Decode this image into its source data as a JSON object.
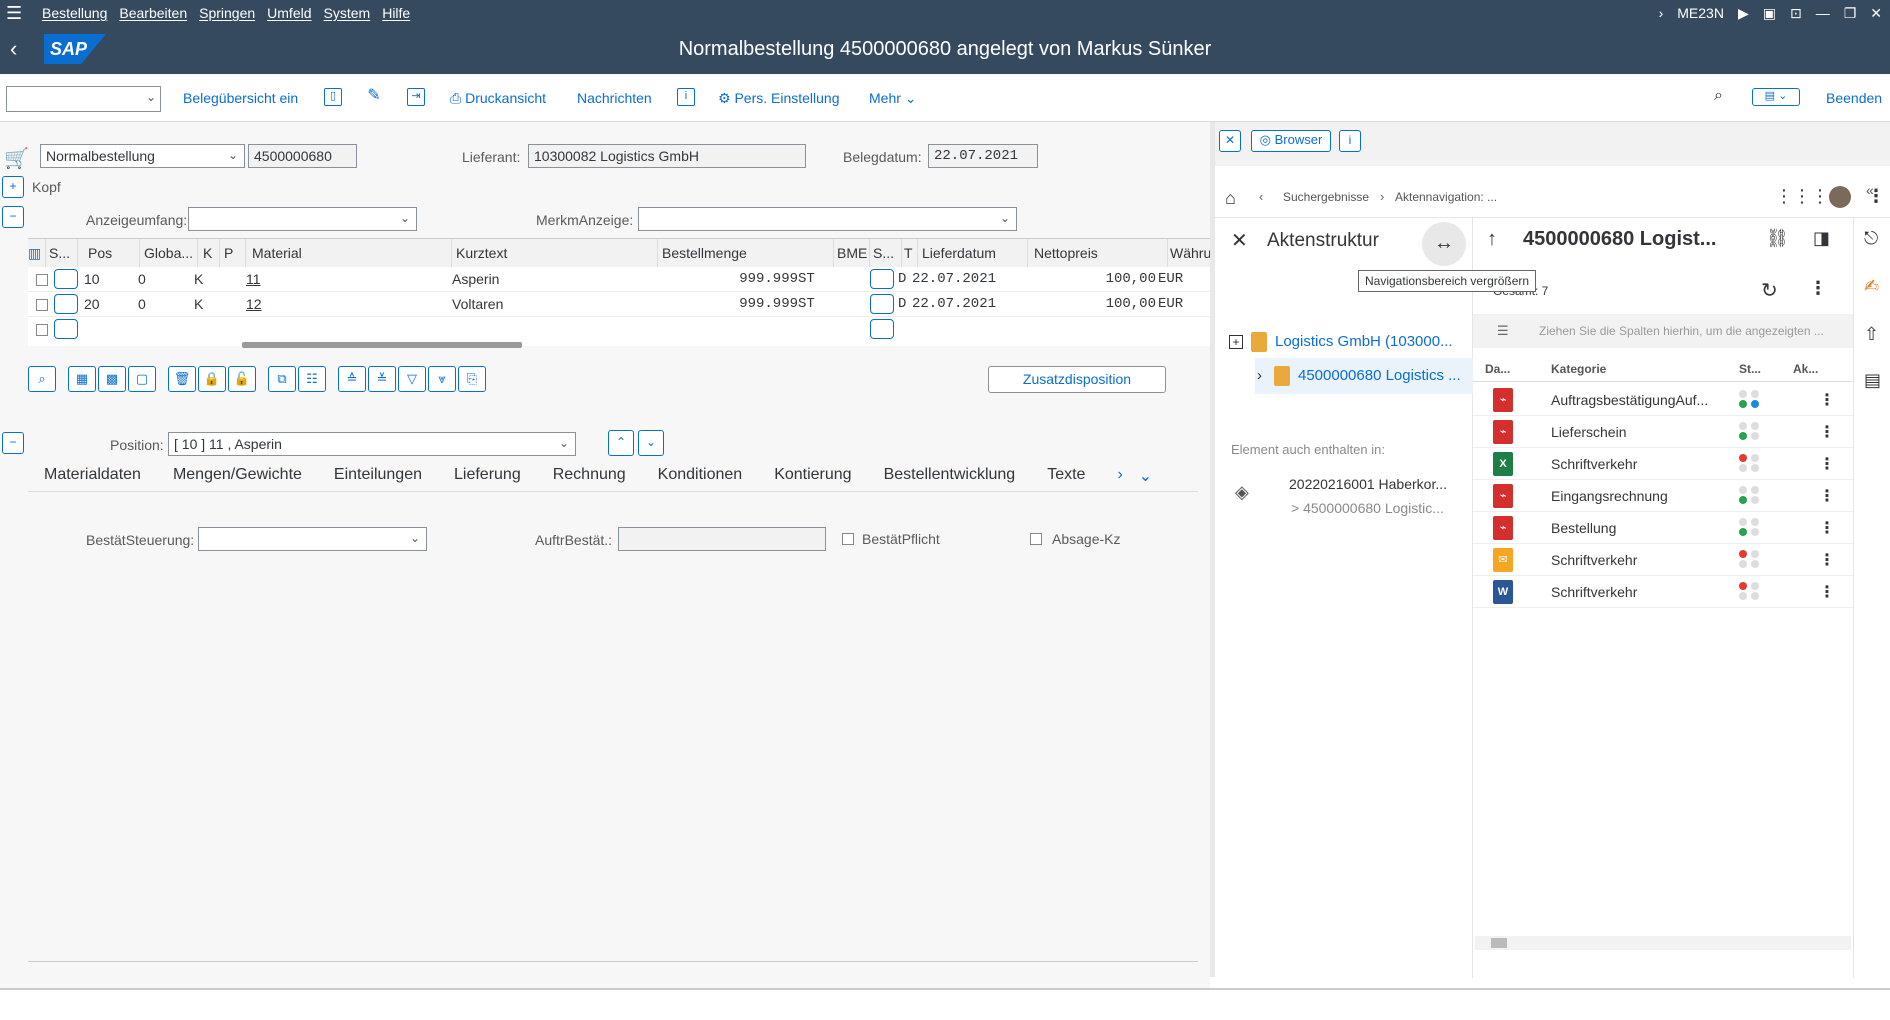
{
  "menu": {
    "items": [
      "Bestellung",
      "Bearbeiten",
      "Springen",
      "Umfeld",
      "System",
      "Hilfe"
    ],
    "tcode": "ME23N"
  },
  "title": "Normalbestellung 4500000680 angelegt von Markus Sünker",
  "toolbar": {
    "beleg": "Belegübersicht ein",
    "druck": "Druckansicht",
    "nachrichten": "Nachrichten",
    "pers": "Pers. Einstellung",
    "mehr": "Mehr",
    "beenden": "Beenden"
  },
  "header": {
    "doctype": "Normalbestellung",
    "docnum": "4500000680",
    "lieferant_label": "Lieferant:",
    "lieferant": "10300082 Logistics GmbH",
    "belegdatum_label": "Belegdatum:",
    "belegdatum": "22.07.2021",
    "kopf": "Kopf",
    "anzeige_label": "Anzeigeumfang:",
    "merkm_label": "MerkmAnzeige:"
  },
  "table": {
    "headers": [
      "S...",
      "Pos",
      "Globa...",
      "K",
      "P",
      "Material",
      "Kurztext",
      "Bestellmenge",
      "BME",
      "S...",
      "T",
      "Lieferdatum",
      "Nettopreis",
      "Währun"
    ],
    "rows": [
      {
        "pos": "10",
        "glob": "0",
        "k": "K",
        "material": "11",
        "kurztext": "Asperin",
        "menge": "999.999",
        "bme": "ST",
        "t": "D",
        "datum": "22.07.2021",
        "preis": "100,00",
        "waehrung": "EUR"
      },
      {
        "pos": "20",
        "glob": "0",
        "k": "K",
        "material": "12",
        "kurztext": "Voltaren",
        "menge": "999.999",
        "bme": "ST",
        "t": "D",
        "datum": "22.07.2021",
        "preis": "100,00",
        "waehrung": "EUR"
      }
    ]
  },
  "zusatz": "Zusatzdisposition",
  "position": {
    "label": "Position:",
    "value": "[ 10 ] 11 , Asperin"
  },
  "tabs": [
    "Materialdaten",
    "Mengen/Gewichte",
    "Einteilungen",
    "Lieferung",
    "Rechnung",
    "Konditionen",
    "Kontierung",
    "Bestellentwicklung",
    "Texte"
  ],
  "detail": {
    "bestaet_label": "BestätSteuerung:",
    "auftr_label": "AuftrBestät.:",
    "pflicht": "BestätPflicht",
    "absage": "Absage-Kz"
  },
  "rp": {
    "browser": "Browser",
    "crumb1": "Suchergebnisse",
    "crumb2": "Aktennavigation: ...",
    "akten": "Aktenstruktur",
    "doc_title": "4500000680 Logist...",
    "tooltip": "Navigationsbereich vergrößern",
    "gesamt": "Gesamt: 7",
    "tree1": "Logistics GmbH (103000...",
    "tree2": "4500000680 Logistics ...",
    "also_in": "Element auch enthalten in:",
    "also_item": "20220216001 Haberkor...",
    "also_sub": "> 4500000680 Logistic...",
    "group_hint": "Ziehen Sie die Spalten hierhin, um die angezeigten ...",
    "col_da": "Da...",
    "col_kat": "Kategorie",
    "col_st": "St...",
    "col_ak": "Ak...",
    "docs": [
      {
        "kat": "AuftragsbestätigungAuf...",
        "icon": "pdf-icon"
      },
      {
        "kat": "Lieferschein",
        "icon": "pdf-icon"
      },
      {
        "kat": "Schriftverkehr",
        "icon": "excel-icon"
      },
      {
        "kat": "Eingangsrechnung",
        "icon": "pdf-icon"
      },
      {
        "kat": "Bestellung",
        "icon": "pdf-icon"
      },
      {
        "kat": "Schriftverkehr",
        "icon": "mail-icon"
      },
      {
        "kat": "Schriftverkehr",
        "icon": "word-icon"
      }
    ]
  }
}
